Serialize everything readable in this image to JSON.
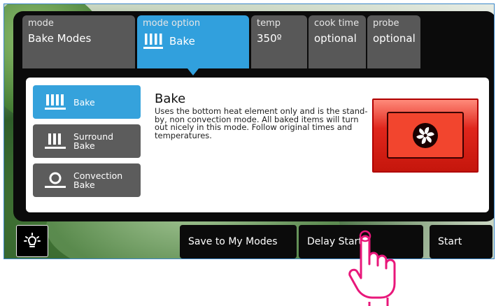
{
  "tabs": [
    {
      "label": "mode",
      "value": "Bake Modes"
    },
    {
      "label": "mode option",
      "value": "Bake"
    },
    {
      "label": "temp",
      "value": "350º"
    },
    {
      "label": "cook time",
      "value": "optional"
    },
    {
      "label": "probe",
      "value": "optional"
    }
  ],
  "options": [
    {
      "label": "Bake",
      "icon": "bake-element-icon"
    },
    {
      "label": "Surround Bake",
      "line1": "Surround",
      "line2": "Bake",
      "icon": "surround-element-icon"
    },
    {
      "label": "Convection Bake",
      "line1": "Convection",
      "line2": "Bake",
      "icon": "convection-icon"
    }
  ],
  "detail": {
    "title": "Bake",
    "description": "Uses the bottom heat element only and is the stand-by, non convection mode. All baked items will turn out nicely in this mode. Follow original times and temperatures.",
    "image_icon": "oven-fan-icon"
  },
  "footer": {
    "light_icon": "oven-light-icon",
    "save_label": "Save to My Modes",
    "delay_label": "Delay Start",
    "start_label": "Start"
  },
  "colors": {
    "accent": "#31a0dd",
    "tab": "#585858",
    "panel": "#0b0b0b",
    "hand": "#e8177a"
  }
}
